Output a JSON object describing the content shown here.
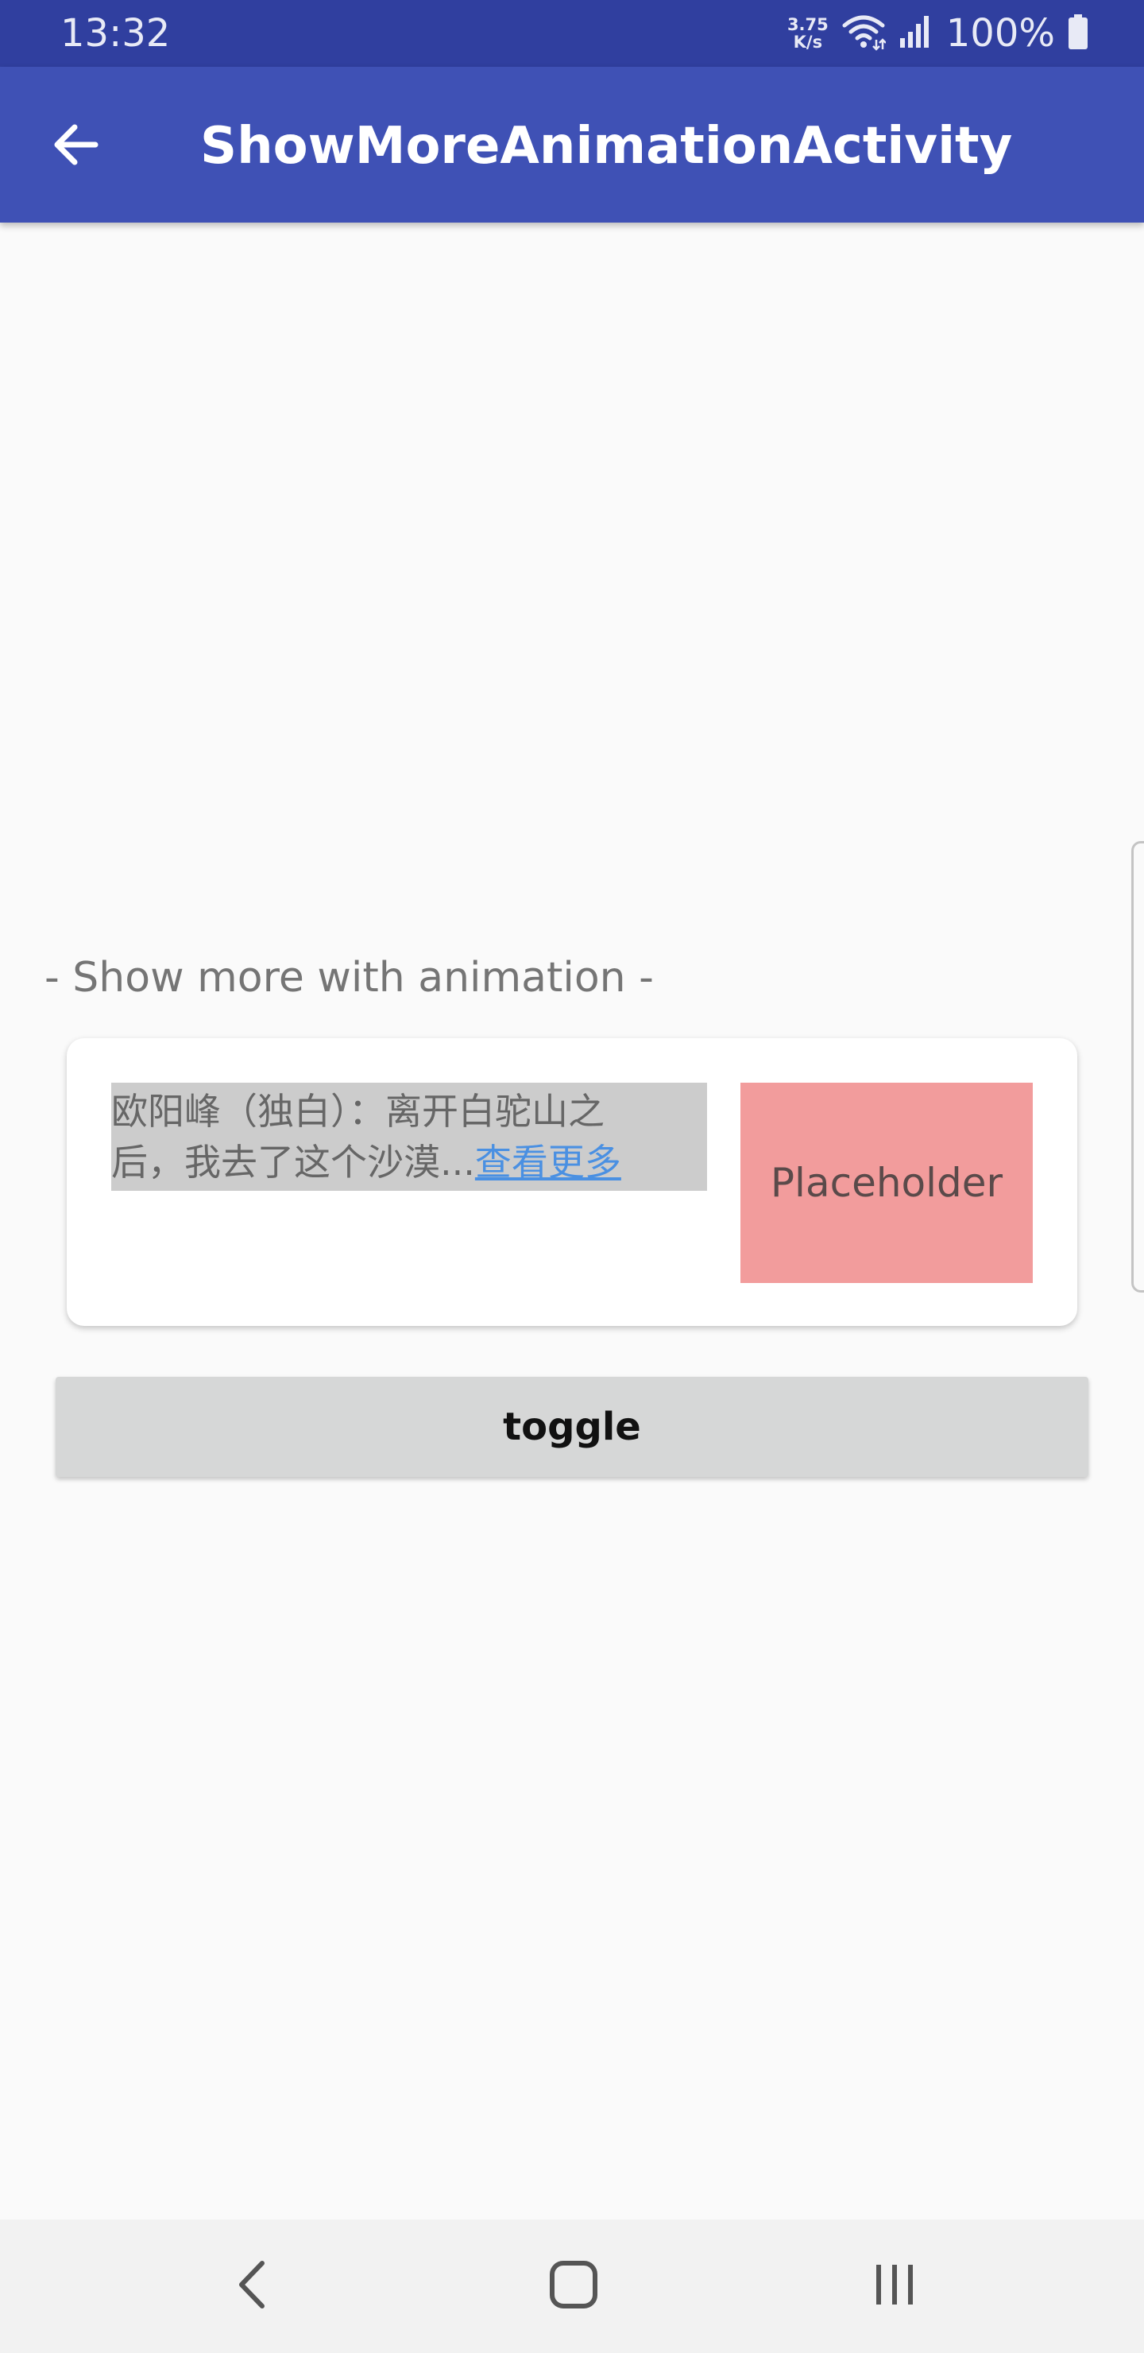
{
  "status_bar": {
    "time": "13:32",
    "net_speed_value": "3.75",
    "net_speed_unit": "K/s",
    "battery_percent": "100%"
  },
  "app_bar": {
    "title": "ShowMoreAnimationActivity",
    "back_icon": "arrow-left-icon"
  },
  "section": {
    "label": "- Show more with animation -"
  },
  "card": {
    "text_line1": "欧阳峰（独白）：离开白驼山之",
    "text_line2": "后，我去了这个沙漠...",
    "more_link": "查看更多",
    "placeholder_label": "Placeholder"
  },
  "toggle_button": {
    "label": "toggle"
  },
  "nav_bar": {
    "back_icon": "chevron-left-icon",
    "home_icon": "home-square-icon",
    "recents_icon": "recents-bars-icon"
  },
  "colors": {
    "status_bar": "#303f9f",
    "app_bar": "#3f51b5",
    "placeholder": "#f29c9c",
    "link": "#4a90e2",
    "button": "#d6d7d7"
  }
}
